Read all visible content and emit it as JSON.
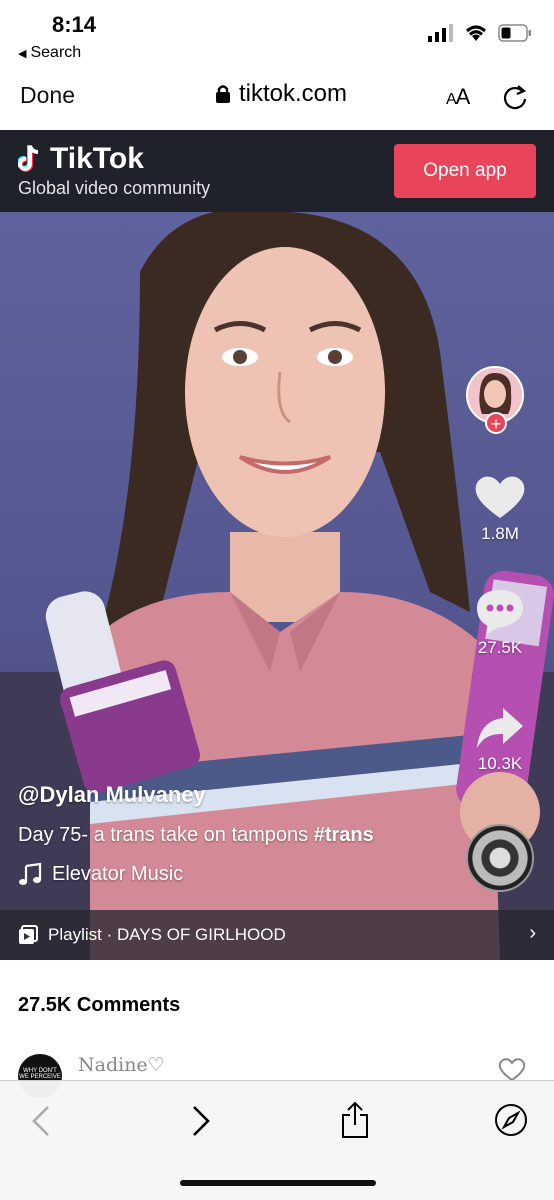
{
  "status_bar": {
    "time": "8:14",
    "back_label": "Search"
  },
  "safari": {
    "done_label": "Done",
    "url": "tiktok.com",
    "text_size_label": "AA"
  },
  "banner": {
    "app_name": "TikTok",
    "tagline": "Global video community",
    "open_app_label": "Open app",
    "accent_color": "#e9455a"
  },
  "video": {
    "likes": "1.8M",
    "comments": "27.5K",
    "shares": "10.3K",
    "author": "@Dylan Mulvaney",
    "caption_text": "Day 75- a trans take on tampons ",
    "caption_hashtag": "#trans",
    "music": "Elevator Music",
    "playlist": "Playlist · DAYS OF GIRLHOOD"
  },
  "comments_section": {
    "count_label": "27.5K Comments",
    "first_comment": {
      "author": "Nadine♡",
      "avatar_text": "WHY DON'T WE PERCEIVE"
    }
  },
  "icons": [
    "lock-icon",
    "reload-icon",
    "tiktok-logo-icon",
    "heart-icon",
    "comment-icon",
    "share-icon",
    "music-note-icon",
    "playlist-icon",
    "chevron-right-icon",
    "back-arrow-icon",
    "forward-arrow-icon",
    "share-sheet-icon",
    "compass-icon"
  ]
}
